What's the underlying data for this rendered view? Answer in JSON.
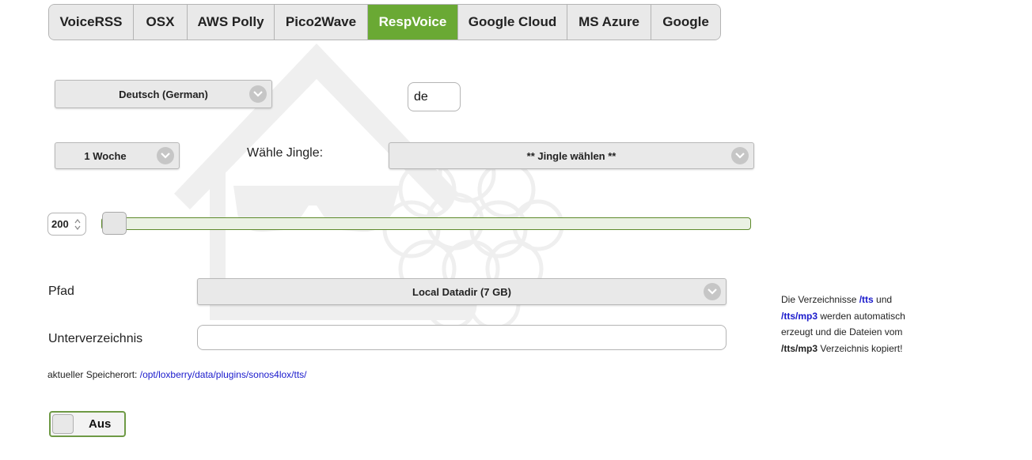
{
  "tabs": [
    {
      "label": "VoiceRSS",
      "active": false
    },
    {
      "label": "OSX",
      "active": false
    },
    {
      "label": "AWS Polly",
      "active": false
    },
    {
      "label": "Pico2Wave",
      "active": false
    },
    {
      "label": "RespVoice",
      "active": true
    },
    {
      "label": "Google Cloud",
      "active": false
    },
    {
      "label": "MS Azure",
      "active": false
    },
    {
      "label": "Google",
      "active": false
    }
  ],
  "language": {
    "selected": "Deutsch (German)",
    "code": "de"
  },
  "cache": {
    "selected": "1 Woche"
  },
  "jingle": {
    "label": "Wähle Jingle:",
    "selected": "** Jingle wählen **"
  },
  "volume": {
    "value": "200"
  },
  "path": {
    "label": "Pfad",
    "selected": "Local Datadir (7 GB)"
  },
  "subdir": {
    "label": "Unterverzeichnis",
    "value": ""
  },
  "storage": {
    "label": "aktueller Speicherort:",
    "path": "/opt/loxberry/data/plugins/sonos4lox/tts/"
  },
  "info": {
    "t1": "Die Verzeichnisse ",
    "l1": "/tts",
    "t2": " und ",
    "l2": "/tts/mp3",
    "t3": " werden automatisch erzeugt und die Dateien vom ",
    "b1": "/tts/mp3",
    "t4": " Verzeichnis kopiert!"
  },
  "toggle": {
    "label": "Aus",
    "state": "off"
  },
  "colors": {
    "accent": "#6aa934",
    "link": "#1a1acc"
  }
}
